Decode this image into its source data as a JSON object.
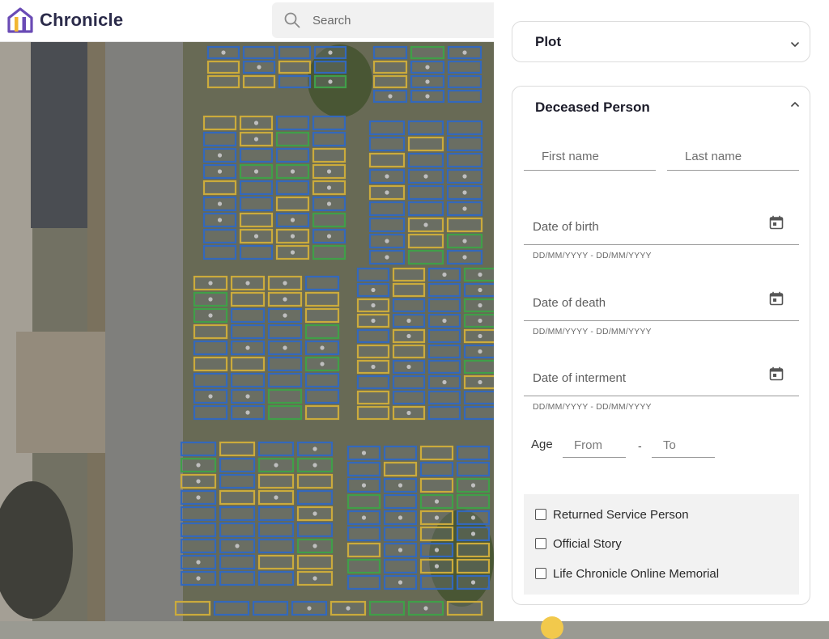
{
  "app": {
    "brand": "Chronicle",
    "accent": "#6a4bb5",
    "accent2": "#f2b632"
  },
  "search": {
    "placeholder": "Search"
  },
  "plot_section": {
    "title": "Plot",
    "expanded": false
  },
  "deceased_section": {
    "title": "Deceased Person",
    "expanded": true,
    "first_name_placeholder": "First name",
    "last_name_placeholder": "Last name",
    "date_of_birth": {
      "label": "Date of birth",
      "helper": "DD/MM/YYYY - DD/MM/YYYY"
    },
    "date_of_death": {
      "label": "Date of death",
      "helper": "DD/MM/YYYY - DD/MM/YYYY"
    },
    "date_of_interment": {
      "label": "Date of interment",
      "helper": "DD/MM/YYYY - DD/MM/YYYY"
    },
    "age": {
      "label": "Age",
      "from_placeholder": "From",
      "separator": "-",
      "to_placeholder": "To"
    },
    "checkboxes": [
      {
        "label": "Returned Service Person",
        "checked": false
      },
      {
        "label": "Official Story",
        "checked": false
      },
      {
        "label": "Life Chronicle Online Memorial",
        "checked": false
      }
    ]
  },
  "map": {
    "plot_colors": {
      "blue": "#2f6fd6",
      "yellow": "#e8c13a",
      "green": "#3fb24a"
    }
  }
}
